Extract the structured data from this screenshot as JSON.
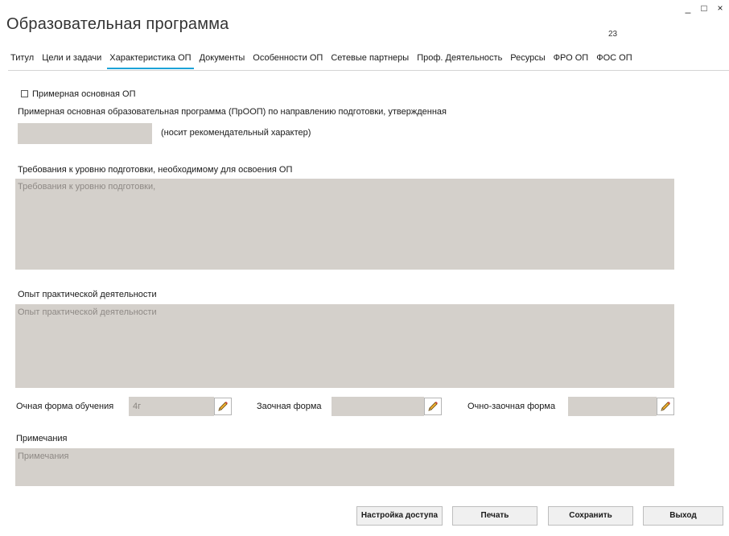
{
  "window": {
    "title": "Образовательная программа",
    "page_number": "23",
    "controls": {
      "minimize": "_",
      "maximize": "□",
      "close": "×"
    }
  },
  "tabs": [
    {
      "label": "Титул",
      "active": false
    },
    {
      "label": "Цели и задачи",
      "active": false
    },
    {
      "label": "Характеристика ОП",
      "active": true
    },
    {
      "label": "Документы",
      "active": false
    },
    {
      "label": "Особенности ОП",
      "active": false
    },
    {
      "label": "Сетевые партнеры",
      "active": false
    },
    {
      "label": "Проф. Деятельность",
      "active": false
    },
    {
      "label": "Ресурсы",
      "active": false
    },
    {
      "label": "ФРО ОП",
      "active": false
    },
    {
      "label": "ФОС ОП",
      "active": false
    }
  ],
  "form": {
    "approx_checkbox_label": "Примерная основная ОП",
    "approx_checkbox_checked": false,
    "proop_label": "Примерная основная образовательная программа (ПрООП) по направлению подготовки, утвержденная",
    "proop_value": "",
    "proop_note": "(носит рекомендательный характер)",
    "requirements_label": "Требования к уровню подготовки, необходимому для освоения ОП",
    "requirements_placeholder": "Требования к уровню подготовки,",
    "experience_label": "Опыт практической деятельности",
    "experience_placeholder": "Опыт практической деятельности",
    "fulltime_label": "Очная форма обучения",
    "fulltime_value": "4г",
    "parttime_label": "Заочная форма",
    "parttime_value": "",
    "mixed_label": "Очно-заочная форма",
    "mixed_value": "",
    "notes_label": "Примечания",
    "notes_placeholder": "Примечания"
  },
  "buttons": {
    "access": "Настройка доступа",
    "print": "Печать",
    "save": "Сохранить",
    "exit": "Выход"
  },
  "colors": {
    "accent": "#1ca3d8",
    "field_bg": "#d4d0cb",
    "pencil": "#f0b030"
  }
}
